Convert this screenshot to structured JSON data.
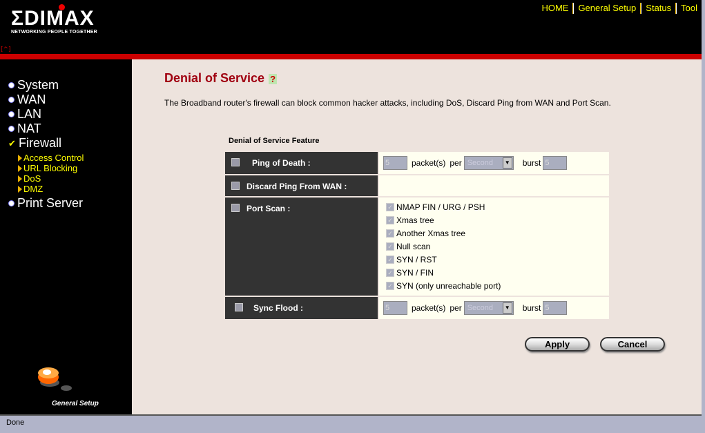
{
  "header": {
    "logo": "EDIMAX",
    "tagline": "NETWORKING PEOPLE TOGETHER",
    "caret": "[^]",
    "nav": [
      "HOME",
      "General Setup",
      "Status",
      "Tool"
    ]
  },
  "sidebar": {
    "items": [
      "System",
      "WAN",
      "LAN",
      "NAT",
      "Firewall",
      "Print Server"
    ],
    "firewall_sub": [
      "Access Control",
      "URL Blocking",
      "DoS",
      "DMZ"
    ],
    "footer": "General Setup"
  },
  "main": {
    "title": "Denial of Service",
    "description": "The Broadband router's firewall can block common hacker attacks, including DoS, Discard Ping from WAN and Port Scan.",
    "feature_heading": "Denial of Service Feature",
    "ping_of_death": {
      "label": "Ping of Death :",
      "packets": "5",
      "packets_label": "packet(s)",
      "per_label": "per",
      "per_value": "Second",
      "burst_label": "burst",
      "burst": "5"
    },
    "discard_ping": {
      "label": "Discard Ping From WAN :"
    },
    "port_scan": {
      "label": "Port Scan :",
      "options": [
        "NMAP FIN / URG / PSH",
        "Xmas tree",
        "Another Xmas tree",
        "Null scan",
        "SYN / RST",
        "SYN / FIN",
        "SYN (only unreachable port)"
      ]
    },
    "sync_flood": {
      "label": "Sync Flood :",
      "packets": "5",
      "packets_label": "packet(s)",
      "per_label": "per",
      "per_value": "Second",
      "burst_label": "burst",
      "burst": "5"
    },
    "apply": "Apply",
    "cancel": "Cancel"
  },
  "status": "Done",
  "colors": {
    "title": "#a00010",
    "nav": "#ffff00",
    "bar": "#cc0000"
  }
}
